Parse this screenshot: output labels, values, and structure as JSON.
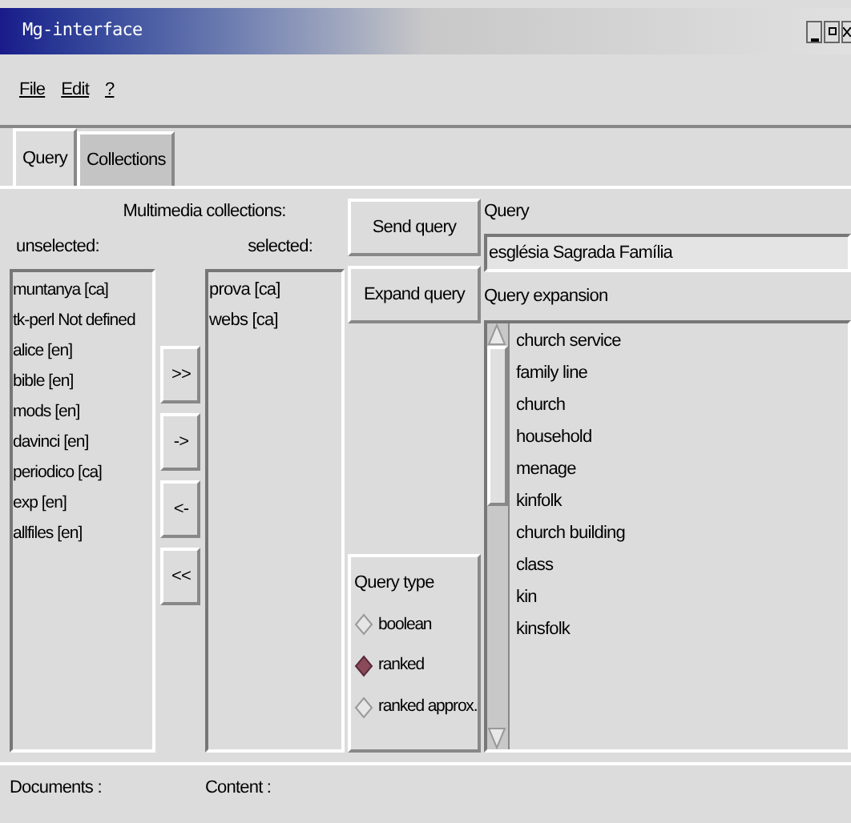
{
  "window": {
    "title": "Mg-interface"
  },
  "menu": [
    "File",
    "Edit",
    "?"
  ],
  "tabs": [
    {
      "label": "Query",
      "selected": true
    },
    {
      "label": "Collections",
      "selected": false
    }
  ],
  "collections": {
    "heading": "Multimedia collections:",
    "unselected_label": "unselected:",
    "selected_label": "selected:",
    "unselected": [
      "muntanya [ca]",
      "tk-perl Not defined",
      "alice [en]",
      "bible [en]",
      "mods [en]",
      "davinci [en]",
      "periodico [ca]",
      "exp [en]",
      "allfiles [en]"
    ],
    "selected": [
      "prova [ca]",
      "webs [ca]"
    ],
    "move_buttons": [
      ">>",
      "->",
      "<-",
      "<<"
    ]
  },
  "buttons": [
    "Send query",
    "Expand query"
  ],
  "query": {
    "label": "Query",
    "value": "església Sagrada Família"
  },
  "query_type": {
    "title": "Query type",
    "options": [
      {
        "label": "boolean",
        "selected": false
      },
      {
        "label": "ranked",
        "selected": true
      },
      {
        "label": "ranked approx.",
        "selected": false
      }
    ]
  },
  "expansion": {
    "label": "Query expansion",
    "items": [
      "church service",
      "family line",
      "church",
      "household",
      "menage",
      "kinfolk",
      "church building",
      "class",
      "kin",
      "kinsfolk"
    ]
  },
  "footer": {
    "documents_label": "Documents :",
    "content_label": "Content :"
  }
}
